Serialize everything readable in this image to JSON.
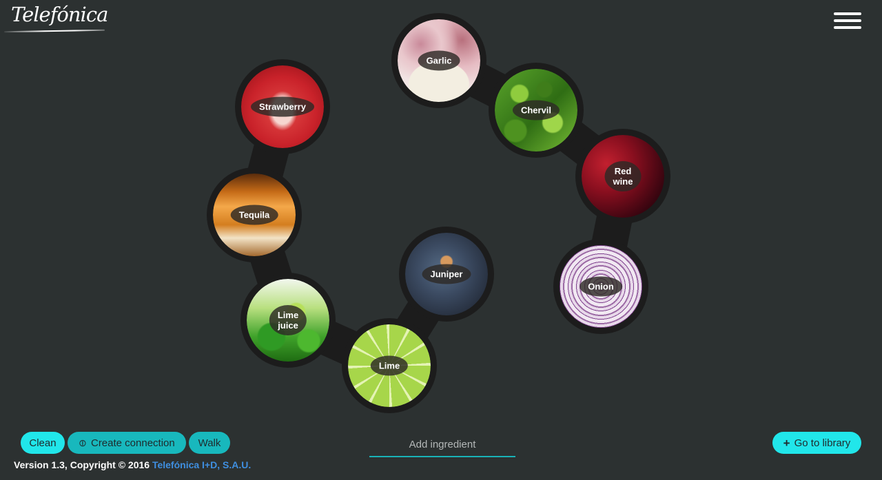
{
  "brand": {
    "logo_text": "Telefónica"
  },
  "menu": {
    "icon": "hamburger-menu-icon"
  },
  "graph": {
    "ingredients": [
      {
        "id": "garlic",
        "label": "Garlic"
      },
      {
        "id": "chervil",
        "label": "Chervil"
      },
      {
        "id": "redwine",
        "label": "Red\nwine"
      },
      {
        "id": "onion",
        "label": "Onion"
      },
      {
        "id": "juniper",
        "label": "Juniper"
      },
      {
        "id": "lime",
        "label": "Lime"
      },
      {
        "id": "limejuice",
        "label": "Lime\njuice"
      },
      {
        "id": "tequila",
        "label": "Tequila"
      },
      {
        "id": "strawberry",
        "label": "Strawberry"
      }
    ],
    "connections": [
      [
        "garlic",
        "chervil"
      ],
      [
        "chervil",
        "redwine"
      ],
      [
        "redwine",
        "onion"
      ],
      [
        "juniper",
        "lime"
      ],
      [
        "lime",
        "limejuice"
      ],
      [
        "limejuice",
        "tequila"
      ],
      [
        "tequila",
        "strawberry"
      ]
    ]
  },
  "toolbar": {
    "clean_label": "Clean",
    "create_connection_label": "Create connection",
    "create_connection_icon": "link-icon",
    "walk_label": "Walk",
    "add_ingredient_placeholder": "Add ingredient",
    "go_to_library_label": "Go to library",
    "go_to_library_icon": "plus-icon"
  },
  "footer": {
    "version_text": "Version 1.3, Copyright © 2016 ",
    "company_link": "Telefónica I+D, S.A.U."
  },
  "colors": {
    "background": "#2c3131",
    "button_cyan": "#21e6ea",
    "button_teal": "#18b8bd",
    "link": "#3f8fe0",
    "node_ring": "#1c1c1c"
  }
}
